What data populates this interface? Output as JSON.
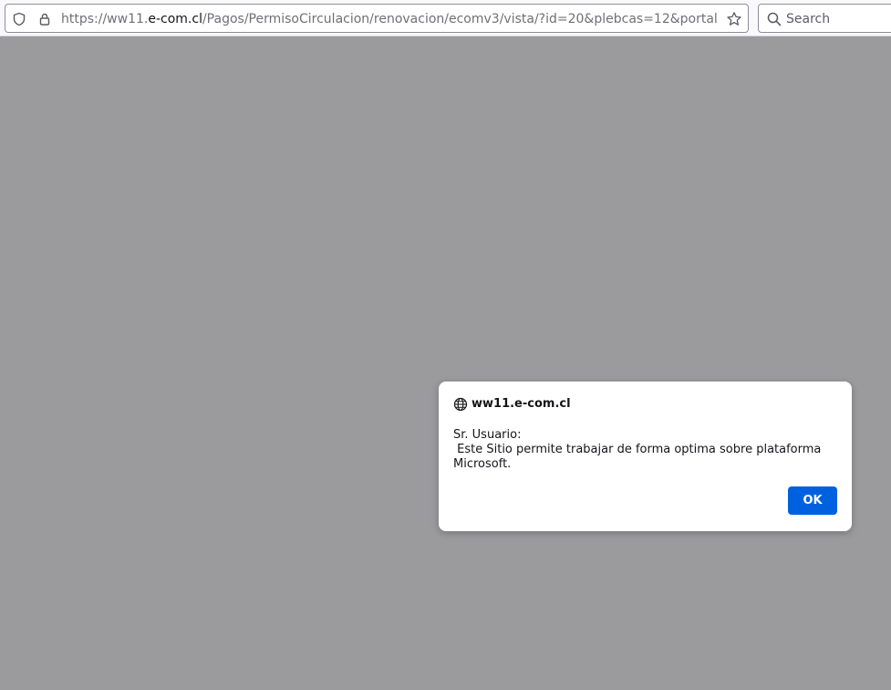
{
  "browser": {
    "url_prefix": "https://ww11.",
    "url_host": "e-com.cl",
    "url_path": "/Pagos/PermisoCirculacion/renovacion/ecomv3/vista/?id=20&plebcas=12&portal",
    "search_placeholder": "Search",
    "icons": {
      "shield": "shield-icon",
      "lock": "lock-icon",
      "star": "bookmark-star-icon",
      "search": "search-icon"
    }
  },
  "dialog": {
    "origin": "ww11.e-com.cl",
    "message": "Sr. Usuario:\n Este Sitio permite trabajar de forma optima sobre plataforma Microsoft.",
    "ok_label": "OK",
    "icon": "globe-icon"
  },
  "colors": {
    "overlay": "#9b9b9e",
    "accent": "#0061e0"
  }
}
